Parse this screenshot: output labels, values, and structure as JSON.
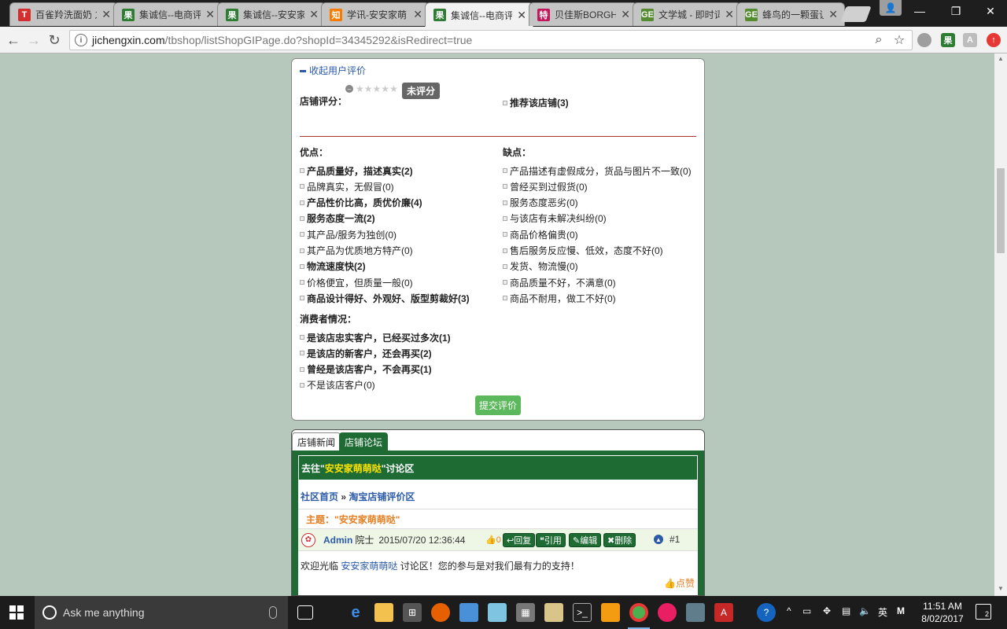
{
  "browser": {
    "tabs": [
      {
        "title": "百雀羚洗面奶 之",
        "favicon": "T",
        "favicon_color": "#d32f2f"
      },
      {
        "title": "集诚信--电商评",
        "favicon": "果",
        "favicon_color": "#2e7d32"
      },
      {
        "title": "集诚信--安安家",
        "favicon": "果",
        "favicon_color": "#2e7d32"
      },
      {
        "title": "学讯-安安家萌",
        "favicon": "知",
        "favicon_color": "#f57c00"
      },
      {
        "title": "集诚信--电商评",
        "favicon": "果",
        "favicon_color": "#2e7d32",
        "active": true
      },
      {
        "title": "贝佳斯BORGHE",
        "favicon": "特",
        "favicon_color": "#c2185b"
      },
      {
        "title": "文学城 - 即时词",
        "favicon": "GE",
        "favicon_color": "#558b2f"
      },
      {
        "title": "蜂鸟的一颗蛋让",
        "favicon": "GE",
        "favicon_color": "#558b2f"
      }
    ],
    "address": {
      "host": "jichengxin.com",
      "path": "/tbshop/listShopGIPage.do?shopId=34345292&isRedirect=true"
    }
  },
  "review": {
    "collapse_label": "收起用户评价",
    "score_label": "店铺评分：",
    "unrated_badge": "未评分",
    "recommend_label": "推荐该店铺(3)",
    "pros_title": "优点：",
    "cons_title": "缺点：",
    "consumer_title": "消费者情况：",
    "pros": [
      {
        "text": "产品质量好，描述真实(2)",
        "bold": true
      },
      {
        "text": "品牌真实，无假冒(0)",
        "bold": false
      },
      {
        "text": "产品性价比高，质优价廉(4)",
        "bold": true
      },
      {
        "text": "服务态度一流(2)",
        "bold": true
      },
      {
        "text": "其产品/服务为独创(0)",
        "bold": false
      },
      {
        "text": "其产品为优质地方特产(0)",
        "bold": false
      },
      {
        "text": "物流速度快(2)",
        "bold": true
      },
      {
        "text": "价格便宜，但质量一般(0)",
        "bold": false
      },
      {
        "text": "商品设计得好、外观好、版型剪裁好(3)",
        "bold": true
      }
    ],
    "cons": [
      {
        "text": "产品描述有虚假成分，货品与图片不一致(0)",
        "bold": false
      },
      {
        "text": "曾经买到过假货(0)",
        "bold": false
      },
      {
        "text": "服务态度恶劣(0)",
        "bold": false
      },
      {
        "text": "与该店有未解决纠纷(0)",
        "bold": false
      },
      {
        "text": "商品价格偏贵(0)",
        "bold": false
      },
      {
        "text": "售后服务反应慢、低效，态度不好(0)",
        "bold": false
      },
      {
        "text": "发货、物流慢(0)",
        "bold": false
      },
      {
        "text": "商品质量不好，不满意(0)",
        "bold": false
      },
      {
        "text": "商品不耐用，做工不好(0)",
        "bold": false
      }
    ],
    "consumer": [
      {
        "text": "是该店忠实客户，已经买过多次(1)",
        "bold": true
      },
      {
        "text": "是该店的新客户，还会再买(2)",
        "bold": true
      },
      {
        "text": "曾经是该店客户，不会再买(1)",
        "bold": true
      },
      {
        "text": "不是该店客户(0)",
        "bold": false
      }
    ],
    "submit_label": "提交评价"
  },
  "forum": {
    "tabs": [
      "店铺新闻",
      "店铺论坛"
    ],
    "head_prefix": "去往\"",
    "head_shop": "安安家萌萌哒",
    "head_suffix": "\"讨论区",
    "crumb_home": "社区首页",
    "crumb_sep": " » ",
    "crumb_section": "淘宝店铺评价区",
    "topic": "主题：\"安安家萌萌哒\"",
    "post": {
      "author": "Admin",
      "rank": "院士",
      "time": "2015/07/20 12:36:44",
      "likes": "0",
      "reply_label": "回复",
      "quote_label": "引用",
      "edit_label": "编辑",
      "delete_label": "删除",
      "floor": "#1",
      "content_prefix": "欢迎光临 ",
      "content_link": "安安家萌萌哒",
      "content_suffix": " 讨论区！您的参与是对我们最有力的支持！",
      "like_label": "点赞"
    }
  },
  "taskbar": {
    "search_placeholder": "Ask me anything",
    "time": "11:51 AM",
    "date": "8/02/2017",
    "lang": "英",
    "notifications": "2"
  }
}
